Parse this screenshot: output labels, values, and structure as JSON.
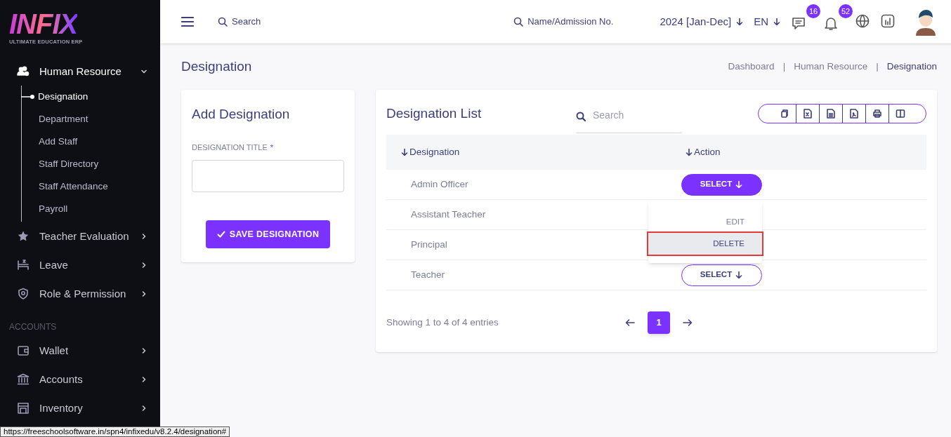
{
  "logo": {
    "title": "INFIX",
    "tagline": "ULTIMATE EDUCATION ERP"
  },
  "sidebar": {
    "groups": [
      {
        "items": [
          {
            "label": "Human Resource",
            "expanded": true,
            "children": [
              {
                "label": "Designation",
                "selected": true
              },
              {
                "label": "Department",
                "selected": false
              },
              {
                "label": "Add Staff",
                "selected": false
              },
              {
                "label": "Staff Directory",
                "selected": false
              },
              {
                "label": "Staff Attendance",
                "selected": false
              },
              {
                "label": "Payroll",
                "selected": false
              }
            ]
          },
          {
            "label": "Teacher Evaluation",
            "expanded": false
          },
          {
            "label": "Leave",
            "expanded": false
          },
          {
            "label": "Role & Permission",
            "expanded": false
          }
        ]
      },
      {
        "heading": "ACCOUNTS",
        "items": [
          {
            "label": "Wallet",
            "expanded": false
          },
          {
            "label": "Accounts",
            "expanded": false
          },
          {
            "label": "Inventory",
            "expanded": false
          }
        ]
      }
    ]
  },
  "topbar": {
    "search_placeholder": "Search",
    "admission_placeholder": "Name/Admission No.",
    "session": "2024 [Jan-Dec]",
    "language": "EN",
    "messages_count": "16",
    "notifications_count": "52"
  },
  "page": {
    "title": "Designation",
    "breadcrumb_separator": "|",
    "breadcrumbs": [
      {
        "label": "Dashboard",
        "selected": false
      },
      {
        "label": "Human Resource",
        "selected": false
      },
      {
        "label": "Designation",
        "selected": true
      }
    ]
  },
  "form": {
    "title": "Add Designation",
    "field_label": "DESIGNATION TITLE",
    "required_mark": "*",
    "button": "SAVE DESIGNATION"
  },
  "list": {
    "title": "Designation List",
    "search_placeholder": "Search",
    "columns": [
      "Designation",
      "Action"
    ],
    "rows": [
      {
        "name": "Admin Officer",
        "action": {
          "label": "SELECT",
          "selected": true
        },
        "menu": [
          {
            "label": "EDIT",
            "selected": false
          },
          {
            "label": "DELETE",
            "selected": true
          }
        ]
      },
      {
        "name": "Assistant Teacher"
      },
      {
        "name": "Principal"
      },
      {
        "name": "Teacher",
        "action": {
          "label": "SELECT",
          "selected": false
        }
      }
    ],
    "info": "Showing 1 to 4 of 4 entries",
    "pages": [
      {
        "label": "1",
        "selected": true
      }
    ]
  },
  "status_bar": {
    "url": "https://freeschoolsoftware.in/spn4/infixedu/v8.2.4/designation#"
  }
}
